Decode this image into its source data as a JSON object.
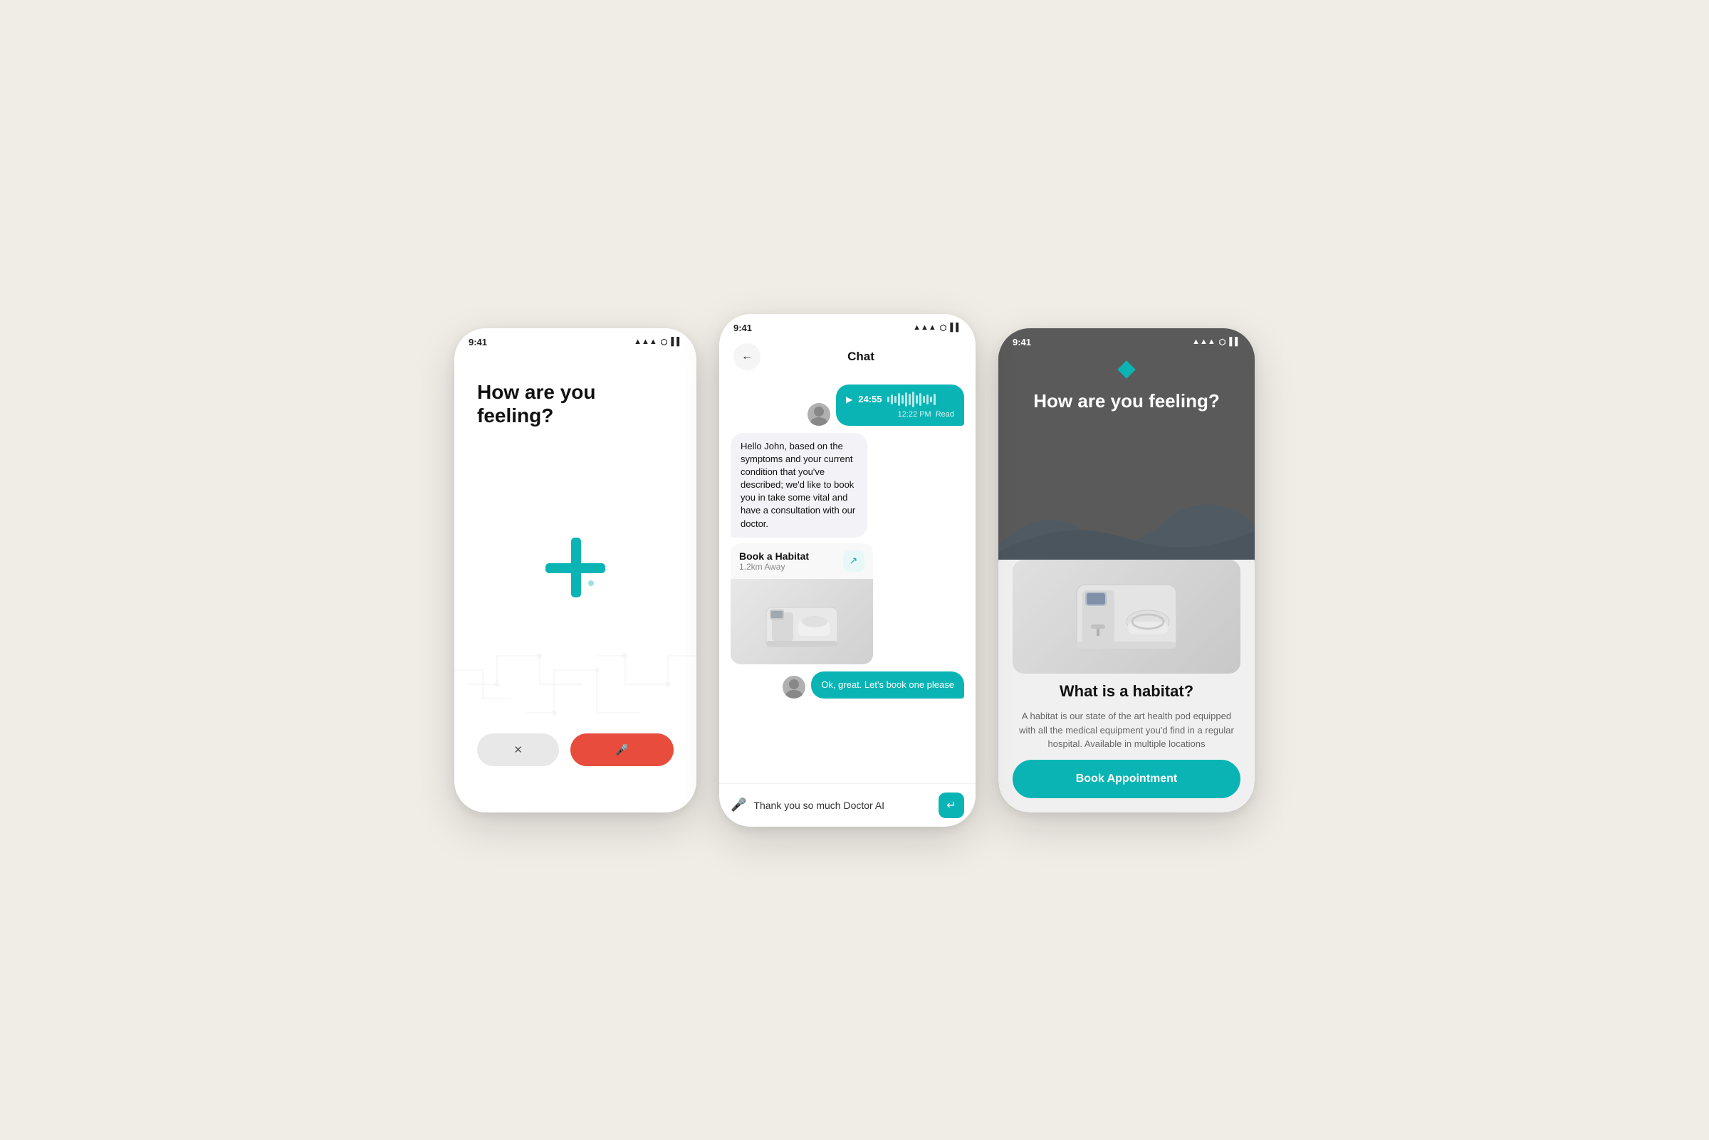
{
  "phone1": {
    "status_time": "9:41",
    "title": "How are you feeling?",
    "cancel_label": "✕",
    "mic_label": "🎤",
    "signal_icons": "▲▲▲ ⬡ ▌▌"
  },
  "phone2": {
    "status_time": "9:41",
    "chat_title": "Chat",
    "back_label": "←",
    "audio_time": "24:55",
    "audio_timestamp": "12:22 PM",
    "audio_read": "Read",
    "message_received": "Hello John, based on the symptoms and your current condition that you've described; we'd like to book you in take some vital and have a consultation with our doctor.",
    "habitat_card_title": "Book a Habitat",
    "habitat_card_distance": "1.2km Away",
    "habitat_link_icon": "↗",
    "message_sent": "Ok, great. Let's book one please",
    "input_placeholder": "Thank you so much Doctor AI",
    "plus_icon": "+",
    "send_icon": "↵",
    "mic_icon": "🎤"
  },
  "phone3": {
    "status_time": "9:41",
    "title": "How are you feeling?",
    "habitat_section_title": "What is a habitat?",
    "habitat_description": "A habitat is our state of the art health pod equipped with all the medical equipment you'd find in a regular hospital. Available in multiple locations",
    "book_button_label": "Book Appointment"
  }
}
